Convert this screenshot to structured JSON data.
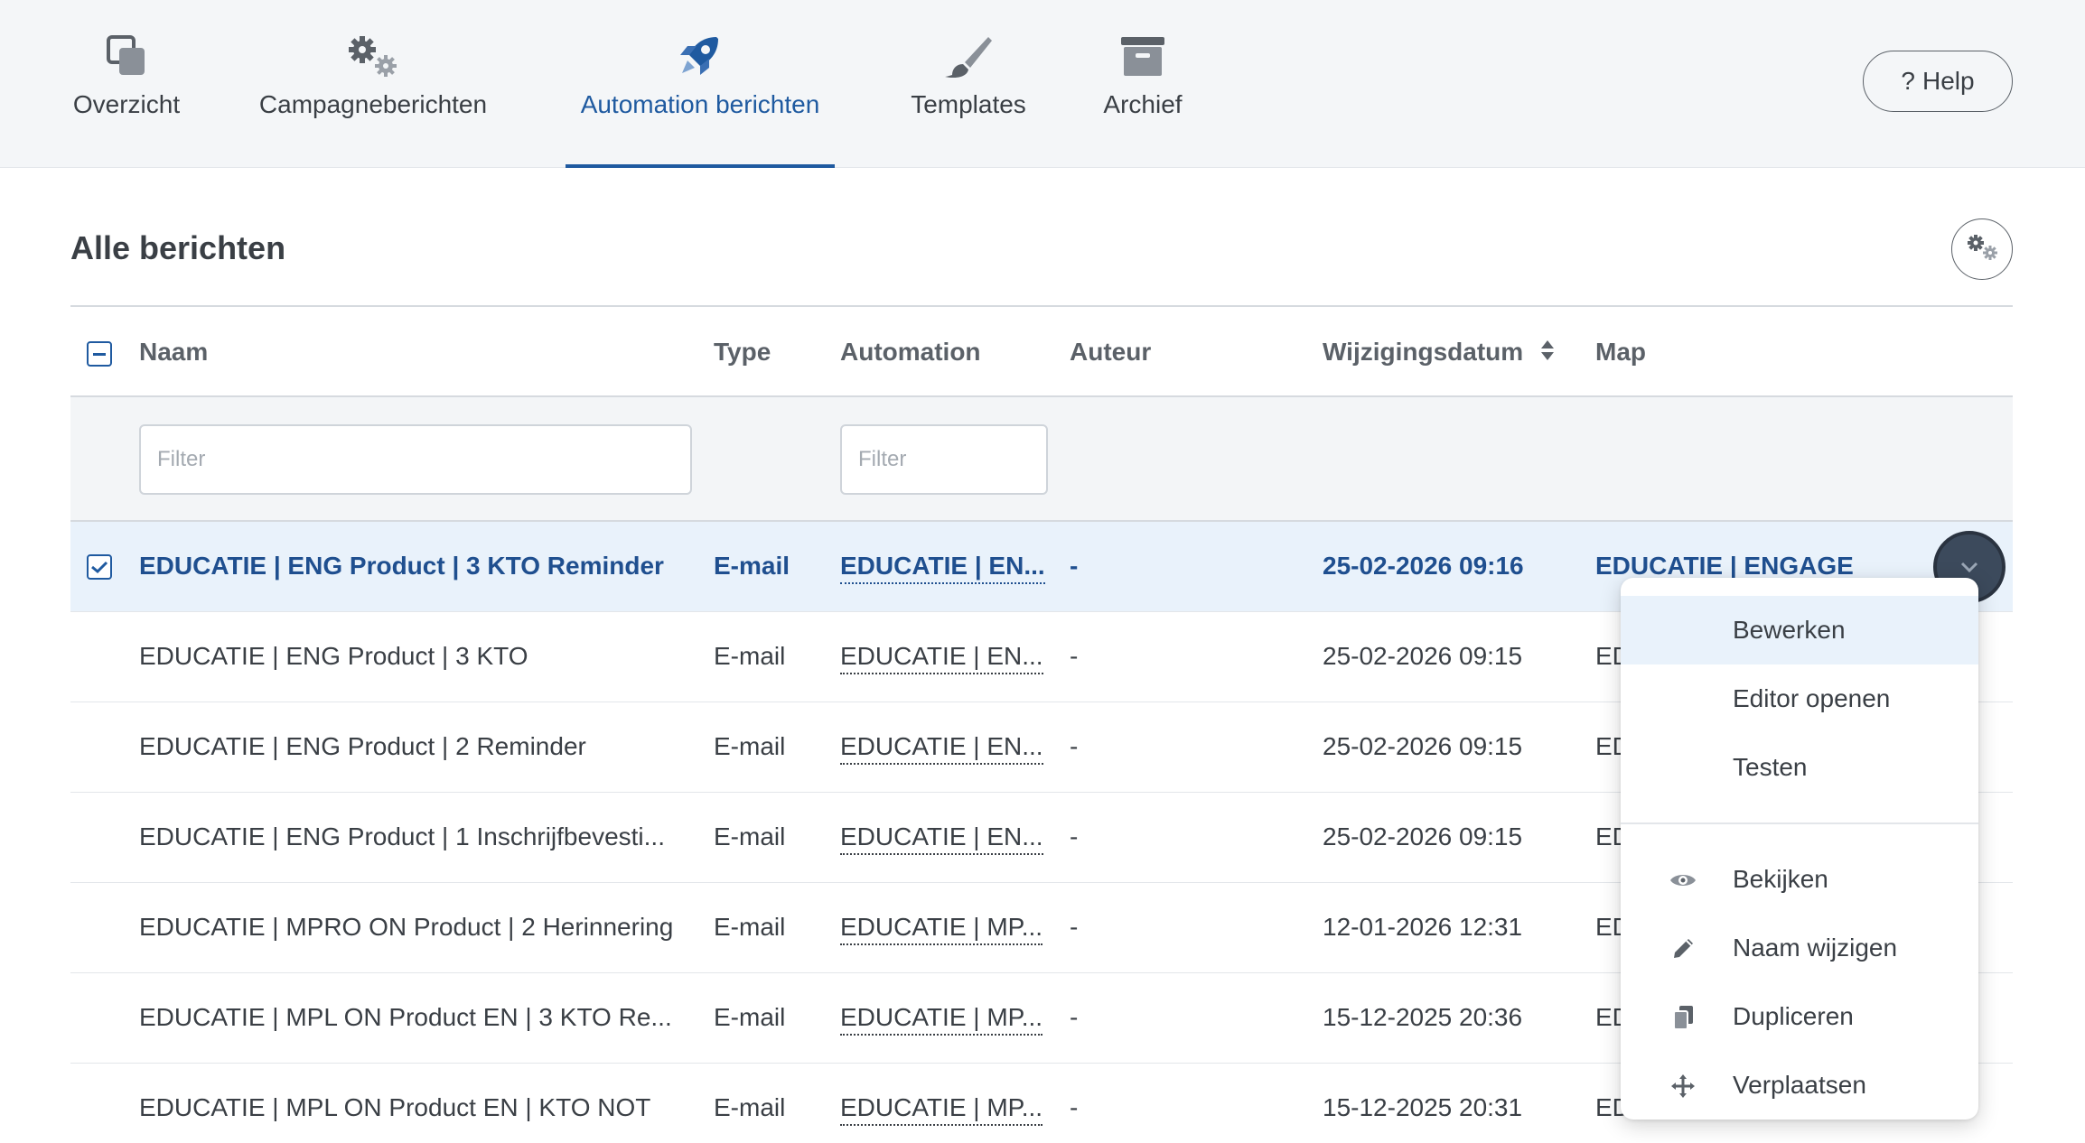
{
  "nav": {
    "items": [
      {
        "label": "Overzicht",
        "icon": "overview-icon"
      },
      {
        "label": "Campagneberichten",
        "icon": "gears-icon"
      },
      {
        "label": "Automation berichten",
        "icon": "rocket-icon",
        "active": true
      },
      {
        "label": "Templates",
        "icon": "paintbrush-icon"
      },
      {
        "label": "Archief",
        "icon": "archive-box-icon"
      }
    ],
    "help_label": "Help",
    "help_icon_glyph": "?"
  },
  "section": {
    "title": "Alle berichten"
  },
  "table": {
    "columns": {
      "name": "Naam",
      "type": "Type",
      "automation": "Automation",
      "author": "Auteur",
      "modified": "Wijzigingsdatum",
      "folder": "Map"
    },
    "filters": {
      "name_placeholder": "Filter",
      "automation_placeholder": "Filter"
    },
    "rows": [
      {
        "name": "EDUCATIE | ENG Product | 3 KTO Reminder",
        "type": "E-mail",
        "automation": "EDUCATIE | EN...",
        "author": "-",
        "modified": "25-02-2026 09:16",
        "folder": "EDUCATIE | ENGAGE",
        "selected": true
      },
      {
        "name": "EDUCATIE | ENG Product | 3 KTO",
        "type": "E-mail",
        "automation": "EDUCATIE | EN...",
        "author": "-",
        "modified": "25-02-2026 09:15",
        "folder": "ED"
      },
      {
        "name": "EDUCATIE | ENG Product | 2 Reminder",
        "type": "E-mail",
        "automation": "EDUCATIE | EN...",
        "author": "-",
        "modified": "25-02-2026 09:15",
        "folder": "ED"
      },
      {
        "name": "EDUCATIE | ENG Product | 1 Inschrijfbevesti...",
        "type": "E-mail",
        "automation": "EDUCATIE | EN...",
        "author": "-",
        "modified": "25-02-2026 09:15",
        "folder": "ED"
      },
      {
        "name": "EDUCATIE | MPRO ON Product | 2 Herinnering",
        "type": "E-mail",
        "automation": "EDUCATIE | MP...",
        "author": "-",
        "modified": "12-01-2026 12:31",
        "folder": "ED"
      },
      {
        "name": "EDUCATIE | MPL ON Product EN | 3 KTO Re...",
        "type": "E-mail",
        "automation": "EDUCATIE | MP...",
        "author": "-",
        "modified": "15-12-2025 20:36",
        "folder": "ED"
      },
      {
        "name": "EDUCATIE | MPL ON Product EN | KTO NOT",
        "type": "E-mail",
        "automation": "EDUCATIE | MP...",
        "author": "-",
        "modified": "15-12-2025 20:31",
        "folder": "ED"
      }
    ]
  },
  "menu": {
    "items": [
      {
        "label": "Bewerken",
        "icon": "",
        "highlight": true
      },
      {
        "label": "Editor openen",
        "icon": ""
      },
      {
        "label": "Testen",
        "icon": ""
      },
      {
        "label": "Bekijken",
        "icon": "eye-icon"
      },
      {
        "label": "Naam wijzigen",
        "icon": "pencil-icon"
      },
      {
        "label": "Dupliceren",
        "icon": "copy-icon"
      },
      {
        "label": "Verplaatsen",
        "icon": "move-icon"
      }
    ]
  },
  "colors": {
    "accent": "#1f5aa0",
    "selected_row_bg": "#e9f2fb",
    "topbar_bg": "#f4f6f8",
    "text": "#3a3f45"
  }
}
